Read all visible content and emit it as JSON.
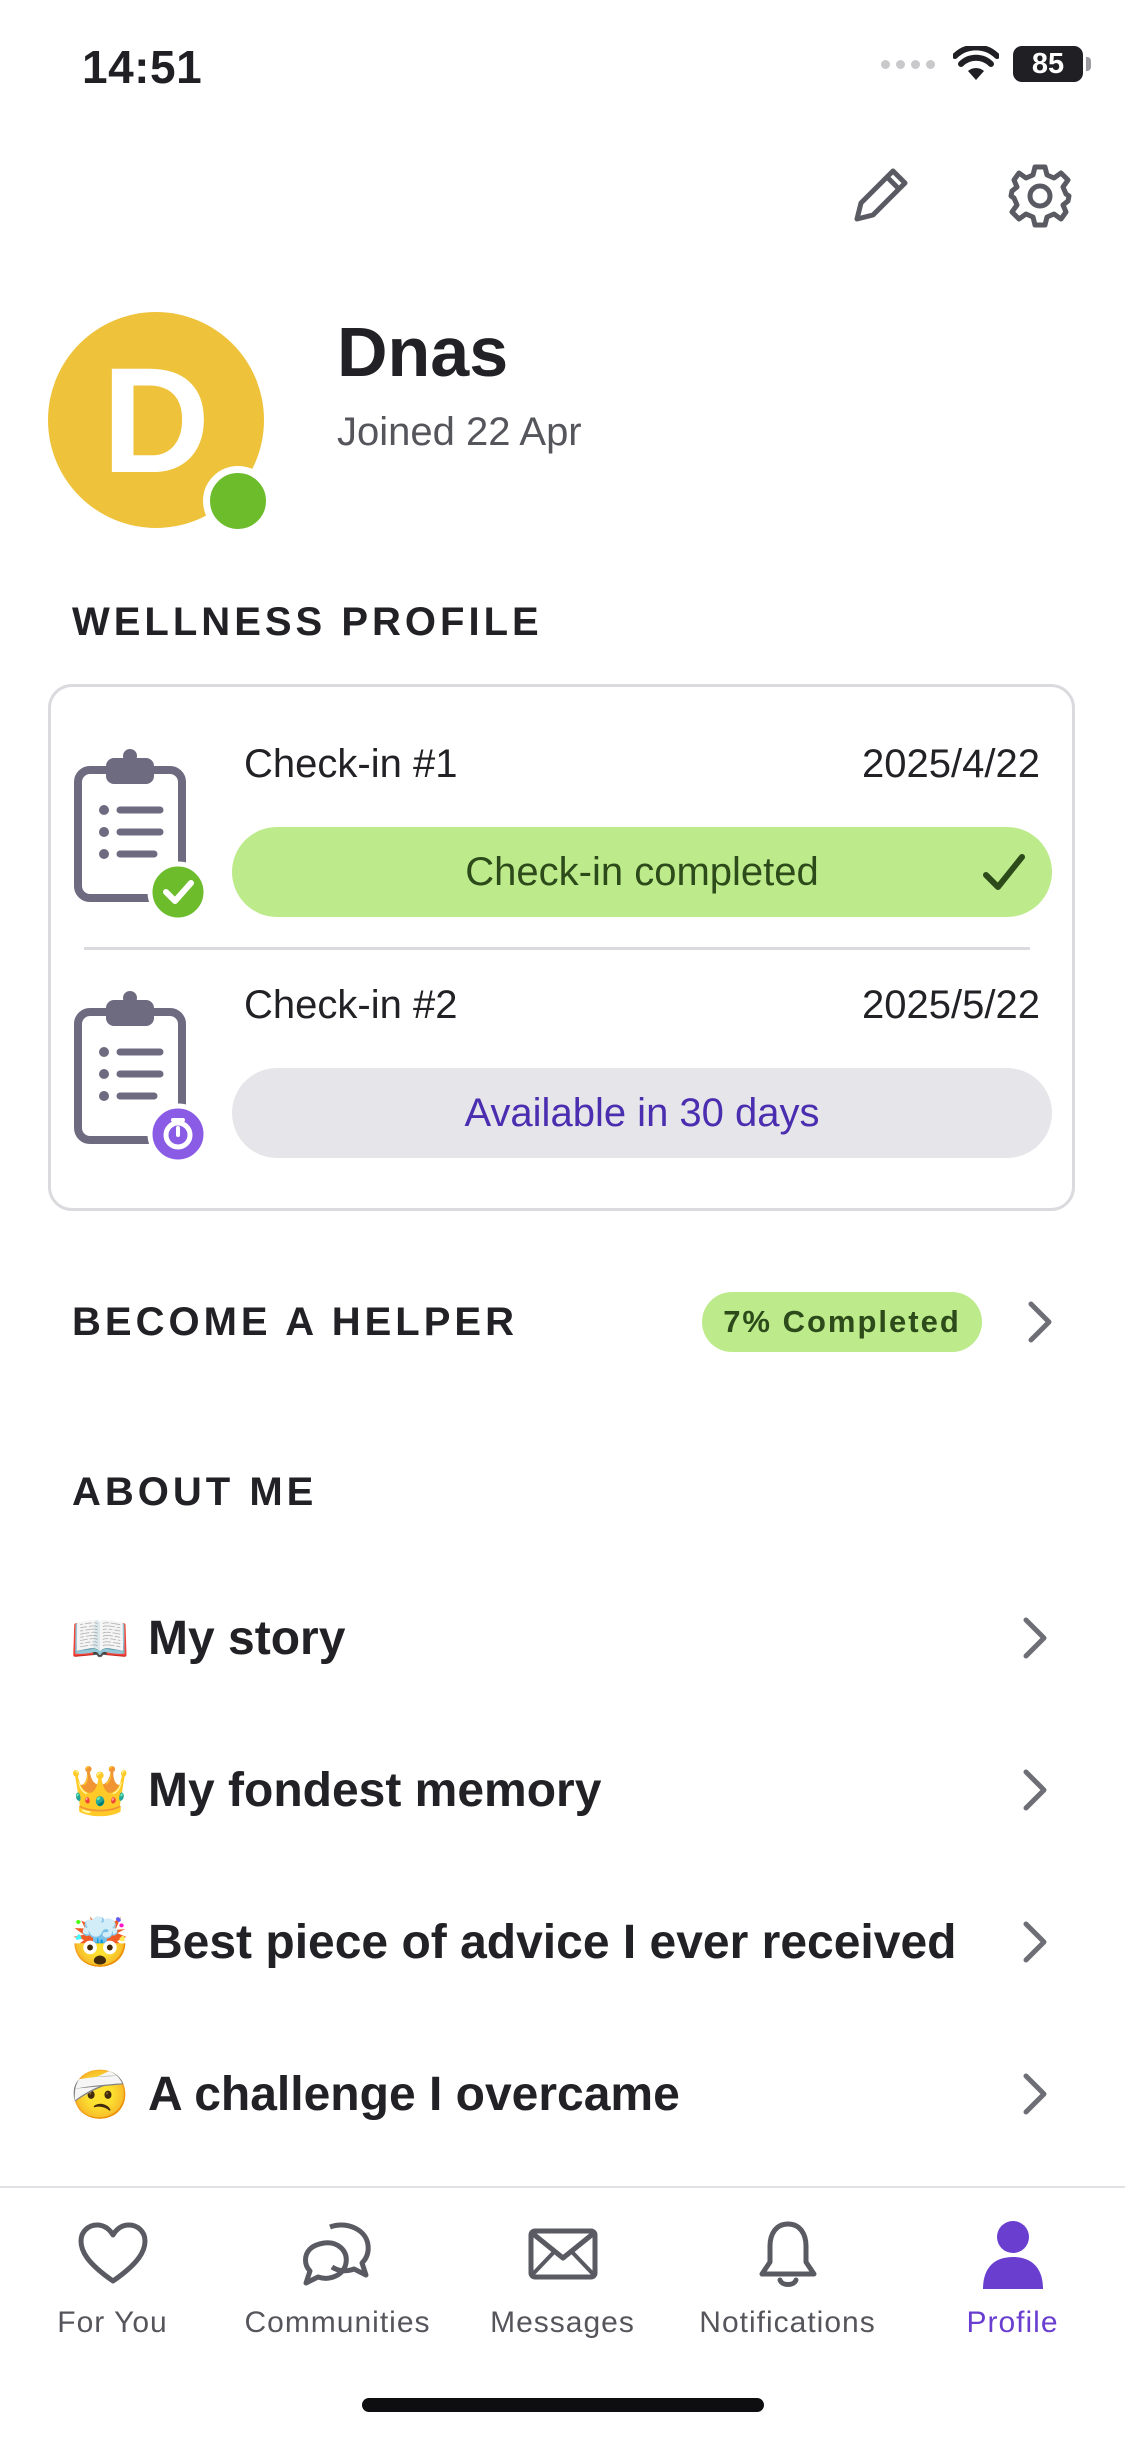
{
  "status_bar": {
    "time": "14:51",
    "battery": "85"
  },
  "profile": {
    "avatar_letter": "D",
    "name": "Dnas",
    "joined": "Joined 22 Apr"
  },
  "wellness": {
    "section_title": "WELLNESS PROFILE",
    "checkins": [
      {
        "title": "Check-in #1",
        "date": "2025/4/22",
        "status": "Check-in completed"
      },
      {
        "title": "Check-in #2",
        "date": "2025/5/22",
        "status": "Available in 30 days"
      }
    ]
  },
  "helper": {
    "title": "BECOME A HELPER",
    "badge": "7% Completed",
    "progress_percent": 7
  },
  "about": {
    "section_title": "ABOUT ME",
    "items": [
      {
        "emoji": "📖",
        "label": "My story"
      },
      {
        "emoji": "👑",
        "label": "My fondest memory"
      },
      {
        "emoji": "🤯",
        "label": "Best piece of advice I ever received"
      },
      {
        "emoji": "🤕",
        "label": "A challenge I overcame"
      }
    ]
  },
  "tabs": [
    {
      "label": "For You",
      "icon": "heart-icon"
    },
    {
      "label": "Communities",
      "icon": "chat-bubbles-icon"
    },
    {
      "label": "Messages",
      "icon": "envelope-icon"
    },
    {
      "label": "Notifications",
      "icon": "bell-icon"
    },
    {
      "label": "Profile",
      "icon": "person-icon",
      "active": true
    }
  ],
  "colors": {
    "accent": "#6a3fd0",
    "success_green": "#bdeb8b",
    "avatar": "#eec23a",
    "online": "#6cbc2c"
  }
}
